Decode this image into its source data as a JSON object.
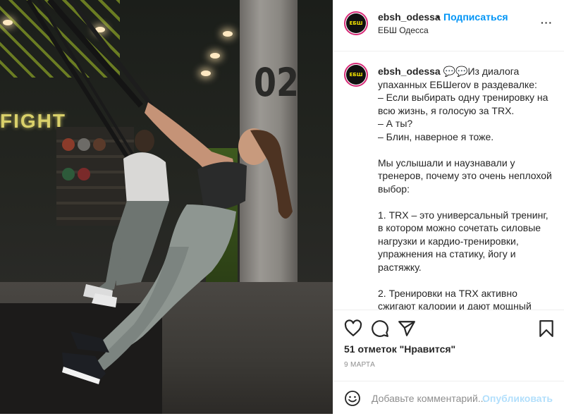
{
  "post": {
    "username": "ebsh_odessa",
    "dot": "•",
    "follow_label": "Подписаться",
    "location": "ЕБШ Одесса",
    "more_label": "···",
    "avatar_logo": "ЕБШ",
    "caption": "ebsh_odessa",
    "caption_body": " 💬💬​Из диалога упаханных ЕБШerov в раздевалке:\n– Если выбирать одну тренировку на всю жизнь, я голосую за TRX.\n– А ты?\n– Блин, наверное я тоже.\n\nМы услышали и наузнавали у тренеров, почему это очень неплохой выбор:\n\n1. TRX – это универсальный тренинг, в котором можно сочетать силовые нагрузки и кардио-тренировки, упражнения на статику, йогу и растяжку.\n\n2. Тренировки на TRX активно сжигают калории и дают мощный метаболический отклик.",
    "likes": "51 отметок \"Нравится\"",
    "date": "9 МАРТА",
    "comment_placeholder": "Добавьте комментарий...",
    "post_label": "Опубликовать"
  },
  "photo": {
    "pillar_number": "02",
    "sign_text": "FIGHT"
  },
  "colors": {
    "accent": "#0095f6",
    "post_disabled": "#b2dffc",
    "avatar_ring": "#d62976",
    "logo_yellow": "#f3e200"
  },
  "icons": [
    "heart-icon",
    "comment-icon",
    "share-icon",
    "bookmark-icon",
    "emoji-icon",
    "more-icon"
  ]
}
